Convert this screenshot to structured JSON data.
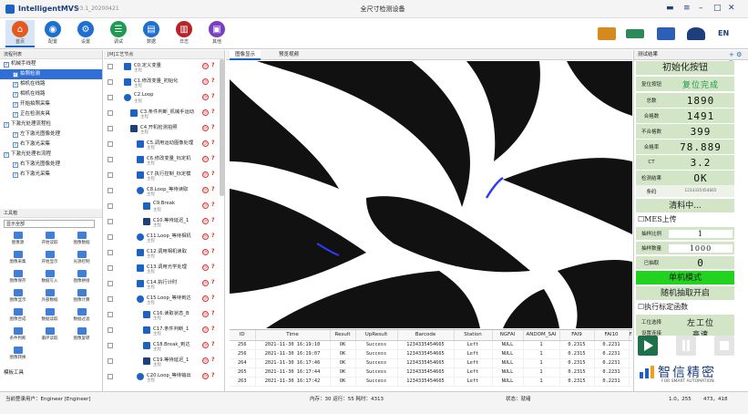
{
  "titlebar": {
    "app_name": "IntelligentMVS",
    "version": "v3.1_20200421",
    "window_title": "全尺寸检测设备",
    "menu_icon": "≡",
    "minimize": "–",
    "maximize": "□",
    "close": "✕",
    "save_icon": "▬"
  },
  "ribbon": {
    "items": [
      {
        "label": "首页",
        "icon": "home-icon",
        "glyph": "⌂",
        "color": "#e35a1e",
        "active": true
      },
      {
        "label": "配置",
        "icon": "config-icon",
        "glyph": "◉",
        "color": "#1d6fd0"
      },
      {
        "label": "设置",
        "icon": "settings-icon",
        "glyph": "⚙",
        "color": "#1d6fd0"
      },
      {
        "label": "调试",
        "icon": "debug-icon",
        "glyph": "☰",
        "color": "#1f9a55"
      },
      {
        "label": "数据",
        "icon": "data-icon",
        "glyph": "▤",
        "color": "#1d6fd0"
      },
      {
        "label": "日志",
        "icon": "log-icon",
        "glyph": "▥",
        "color": "#b8232a"
      },
      {
        "label": "其他",
        "icon": "other-icon",
        "glyph": "▣",
        "color": "#7a3fc0"
      }
    ],
    "lang": "EN"
  },
  "left": {
    "header": "流程列表",
    "tree": [
      {
        "label": "机械手线程",
        "level": 0,
        "checked": true
      },
      {
        "label": "拍照检测",
        "level": 1,
        "checked": true,
        "selected": true
      },
      {
        "label": "相机在线路",
        "level": 1,
        "checked": true
      },
      {
        "label": "相机在线路",
        "level": 1,
        "checked": true
      },
      {
        "label": "开始拍照采集",
        "level": 1,
        "checked": true
      },
      {
        "label": "正在检测夹具",
        "level": 1,
        "checked": true
      },
      {
        "label": "下激光处理流程检",
        "level": 0,
        "checked": true
      },
      {
        "label": "左下激光图像处理",
        "level": 1,
        "checked": true
      },
      {
        "label": "右下激光采集",
        "level": 1,
        "checked": true
      },
      {
        "label": "下激光处理右流程",
        "level": 0,
        "checked": true
      },
      {
        "label": "右下激光图像处理",
        "level": 1,
        "checked": true
      },
      {
        "label": "右下激光采集",
        "level": 1,
        "checked": true
      }
    ],
    "tools_header": "工具箱",
    "tools_filter": "显示全部",
    "tools": [
      "图像源",
      "开始读取",
      "图像数据",
      "图像采集",
      "开始显示",
      "光源控制",
      "图像保存",
      "数据写入",
      "图像拼接",
      "图像显示",
      "外部数据",
      "图像计算",
      "图像合成",
      "数据读取",
      "数据过滤",
      "条件判断",
      "循环读取",
      "图像旋转",
      "图像转换"
    ],
    "section2": "模板工具"
  },
  "process": {
    "header": "[M]工艺节点",
    "items": [
      {
        "name": "C0.定义变量",
        "sub": "主程",
        "indent": 0,
        "icon": "variable-icon"
      },
      {
        "name": "C1.修改变量_初始化",
        "sub": "主程",
        "indent": 0,
        "icon": "modify-icon"
      },
      {
        "name": "C2.Loop",
        "sub": "主程",
        "indent": 0,
        "icon": "loop-icon"
      },
      {
        "name": "C3.条件判断_机械手运动",
        "sub": "主程",
        "indent": 1,
        "icon": "branch-icon"
      },
      {
        "name": "C4.开机检测拍照",
        "sub": "主程",
        "indent": 1,
        "icon": "camera-icon"
      },
      {
        "name": "C5.调用运动图像处理",
        "sub": "主程",
        "indent": 2,
        "icon": "play-icon"
      },
      {
        "name": "C6.修改变量_标定机",
        "sub": "主程",
        "indent": 2,
        "icon": "modify-icon"
      },
      {
        "name": "C7.执行控制_标定模",
        "sub": "主程",
        "indent": 2,
        "icon": "exec-icon"
      },
      {
        "name": "C8.Loop_等待读取",
        "sub": "主程",
        "indent": 2,
        "icon": "loop-icon"
      },
      {
        "name": "C9.Break",
        "sub": "主程",
        "indent": 3,
        "icon": "break-icon"
      },
      {
        "name": "C10.等待延迟_1",
        "sub": "主程",
        "indent": 3,
        "icon": "hourglass-icon"
      },
      {
        "name": "C11.Loop_等待相机",
        "sub": "主程",
        "indent": 2,
        "icon": "loop-icon"
      },
      {
        "name": "C12.调用相机读取",
        "sub": "主程",
        "indent": 2,
        "icon": "play-icon"
      },
      {
        "name": "C13.调用光学处理",
        "sub": "主程",
        "indent": 2,
        "icon": "play-icon"
      },
      {
        "name": "C14.执行计时",
        "sub": "主程",
        "indent": 2,
        "icon": "timer-icon"
      },
      {
        "name": "C15.Loop_等待到达",
        "sub": "主程",
        "indent": 2,
        "icon": "loop-icon"
      },
      {
        "name": "C16.读取状态_B",
        "sub": "主程",
        "indent": 3,
        "icon": "read-icon"
      },
      {
        "name": "C17.条件判断_1",
        "sub": "主程",
        "indent": 3,
        "icon": "branch-icon"
      },
      {
        "name": "C18.Break_到达",
        "sub": "主程",
        "indent": 3,
        "icon": "break-icon"
      },
      {
        "name": "C19.等待延迟_1",
        "sub": "主程",
        "indent": 3,
        "icon": "hourglass-icon"
      },
      {
        "name": "C20.Loop_等待输出",
        "sub": "主程",
        "indent": 2,
        "icon": "loop-icon"
      }
    ]
  },
  "center": {
    "tabs": [
      "图像显示",
      "预览视频"
    ],
    "columns": [
      "ID",
      "Time",
      "Result",
      "UpResult",
      "Barcode",
      "Station",
      "NGFAI",
      "ANDOM_SAI",
      "FAI9",
      "FAI10",
      "FA"
    ],
    "rows": [
      [
        "256",
        "2021-11-30 16:19:10",
        "OK",
        "Success",
        "1234335454665",
        "Left",
        "NULL",
        "1",
        "0.2315",
        "0.2231",
        ""
      ],
      [
        "256",
        "2021-11-30 16:19:07",
        "OK",
        "Success",
        "1234335454665",
        "Left",
        "NULL",
        "1",
        "0.2315",
        "0.2231",
        ""
      ],
      [
        "264",
        "2021-11-30 16:17:46",
        "OK",
        "Success",
        "1234335454665",
        "Left",
        "NULL",
        "1",
        "0.2315",
        "0.2231",
        ""
      ],
      [
        "265",
        "2021-11-30 16:17:44",
        "OK",
        "Success",
        "1234335454665",
        "Left",
        "NULL",
        "1",
        "0.2315",
        "0.2231",
        ""
      ],
      [
        "263",
        "2021-11-30 16:17:42",
        "OK",
        "Success",
        "1234335454665",
        "Left",
        "NULL",
        "1",
        "0.2315",
        "0.2231",
        ""
      ]
    ]
  },
  "right": {
    "header": "测试结果",
    "init_button": "初始化按钮",
    "reset_label": "复位按钮",
    "reset_value": "复位完成",
    "stats": [
      {
        "label": "总数",
        "value": "1890"
      },
      {
        "label": "合格数",
        "value": "1491"
      },
      {
        "label": "不合格数",
        "value": "399"
      },
      {
        "label": "合格率",
        "value": "78.889"
      },
      {
        "label": "CT",
        "value": "3.2"
      },
      {
        "label": "检测结果",
        "value": "OK"
      }
    ],
    "barcode_label": "条码",
    "barcode_value": "1234335454665",
    "clear_button": "清料中...",
    "mes_label": "☐MES上传",
    "sample_ratio_label": "抽样比例",
    "sample_ratio_value": "1",
    "sample_count_label": "抽样数量",
    "sample_count_value": "1000",
    "sampled_label": "已抽取",
    "sampled_value": "0",
    "single_mode": "单机模式",
    "random_sample": "随机抽取开启",
    "calibrate_label": "☐执行标定函数",
    "station_label": "工位选择",
    "station_value": "左工位",
    "next_label": "设置连接",
    "next_value": "高速",
    "brand_name": "智信精密",
    "brand_sub": "FOR SMART AUTOMATION",
    "colors": {
      "green_panel": "#d3e5c7",
      "bright_green": "#21d31f",
      "play": "#1f6f4a"
    }
  },
  "status": {
    "left": "当前登录用户：Engineer [Engineer]",
    "mid": "内存：30  运行：55  耗时：4313",
    "state": "状态：就绪",
    "r1": "1.0，255",
    "r2": "473，418"
  }
}
